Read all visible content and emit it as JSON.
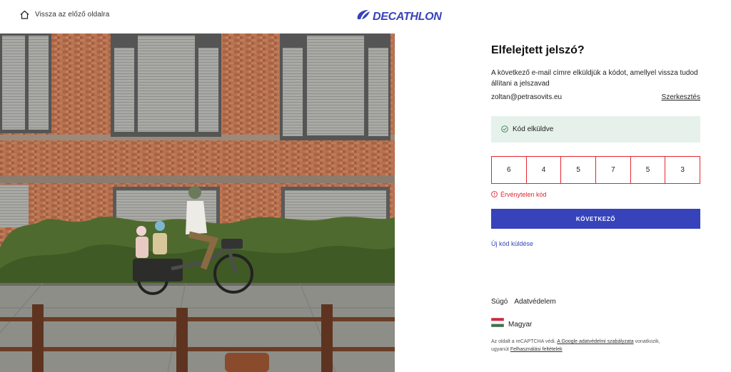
{
  "header": {
    "back_label": "Vissza az előző oldalra",
    "logo_text": "DECATHLON",
    "brand_color": "#3643BA"
  },
  "form": {
    "title": "Elfelejtett jelszó?",
    "description": "A következő e-mail címre elküldjük a kódot, amellyel vissza tudod állítani a jelszavad",
    "email": "zoltan@petrasovits.eu",
    "edit_label": "Szerkesztés",
    "sent_banner": "Kód elküldve",
    "otp_digits": [
      "6",
      "4",
      "5",
      "7",
      "5",
      "3"
    ],
    "error_text": "Érvénytelen kód",
    "error_color": "#E3262F",
    "success_bg": "#E6F1EC",
    "next_button": "KÖVETKEZŐ",
    "resend_label": "Új kód küldése"
  },
  "footer": {
    "help": "Súgó",
    "privacy": "Adatvédelem",
    "language": "Magyar",
    "recaptcha_prefix": "Az oldalt a reCAPTCHA védi. ",
    "recaptcha_privacy_link": "A Google adatvédelmi szabályzata",
    "recaptcha_middle": " vonatkozik, ",
    "recaptcha_line2_prefix": "ugyanút ",
    "recaptcha_terms_link": "Felhasználási feltételek"
  }
}
